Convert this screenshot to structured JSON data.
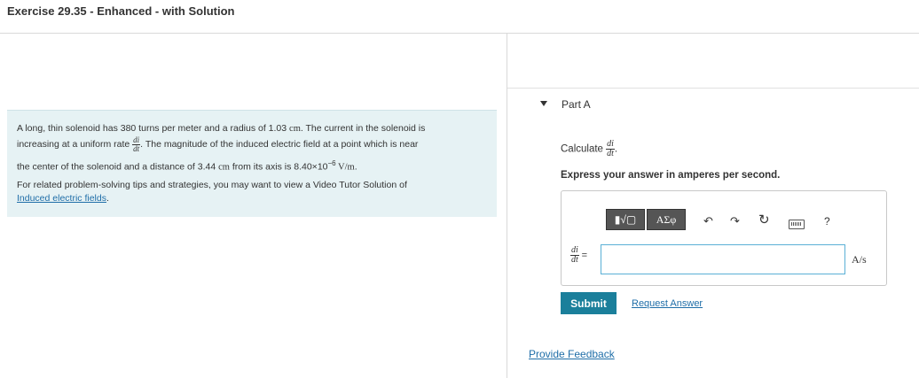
{
  "header": {
    "title": "Exercise 29.35 - Enhanced - with Solution"
  },
  "problem": {
    "l1_a": "A long, thin solenoid has 380 turns per meter and a radius of 1.03 ",
    "l1_unit": "cm",
    "l1_b": ". The current in the solenoid is",
    "l2_a": "increasing at a uniform rate ",
    "frac_num": "di",
    "frac_den": "dt",
    "l2_b": ". The magnitude of the induced electric field at a point which is near",
    "l3_a": "the center of the solenoid and a distance of 3.44 ",
    "l3_unit": "cm",
    "l3_b": " from its axis is 8.40×10",
    "l3_exp": "−6",
    "l3_unit2": " V/m",
    "l3_end": ".",
    "tips": "For related problem-solving tips and strategies, you may want to view a Video Tutor Solution of",
    "link": "Induced electric fields",
    "link_end": "."
  },
  "part": {
    "label": "Part A",
    "calc_label": "Calculate ",
    "calc_num": "di",
    "calc_den": "dt",
    "calc_end": ".",
    "express": "Express your answer in amperes per second."
  },
  "toolbar": {
    "template_glyph": "▮√▢",
    "greek_label": "ΑΣφ",
    "undo_icon": "↶",
    "redo_icon": "↷",
    "reset_icon": "↻",
    "help_label": "?"
  },
  "answer": {
    "lhs_num": "di",
    "lhs_den": "dt",
    "equals": "=",
    "value": "",
    "unit": "A/s"
  },
  "actions": {
    "submit": "Submit",
    "request": "Request Answer",
    "feedback": "Provide Feedback"
  }
}
